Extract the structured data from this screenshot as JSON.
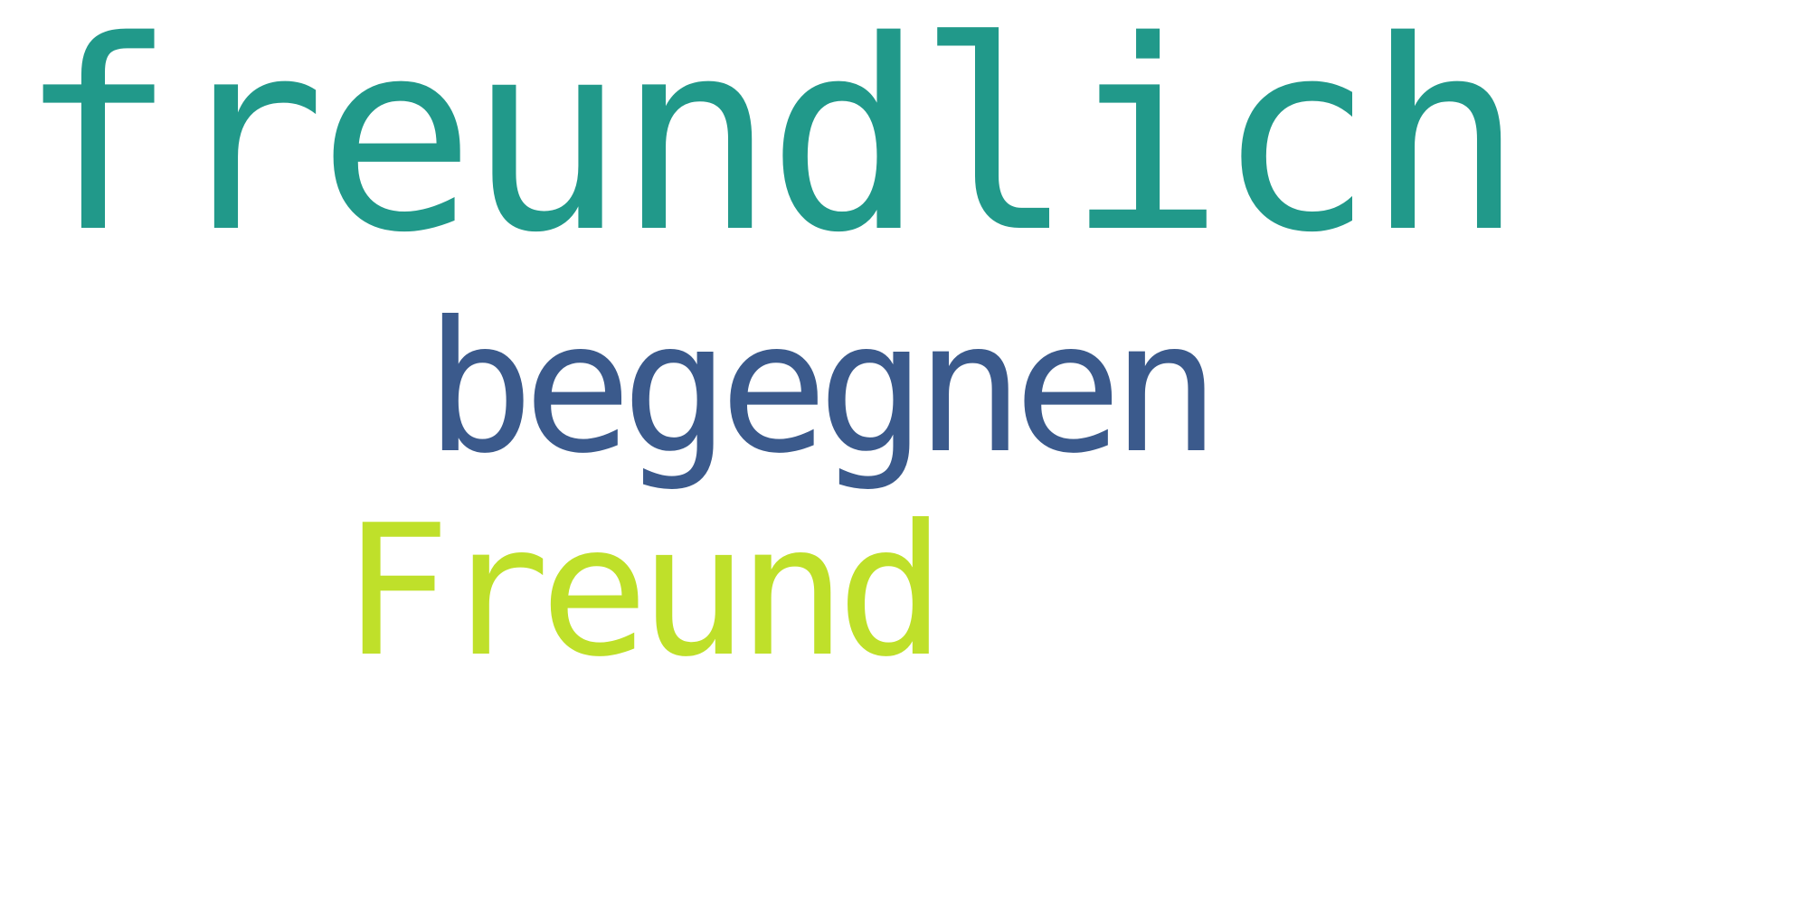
{
  "words": [
    {
      "text": "freundlich",
      "color": "#21998a"
    },
    {
      "text": "begegnen",
      "color": "#3b5a8c"
    },
    {
      "text": "Freund",
      "color": "#bfe02a"
    }
  ],
  "background_color": "#ffffff"
}
